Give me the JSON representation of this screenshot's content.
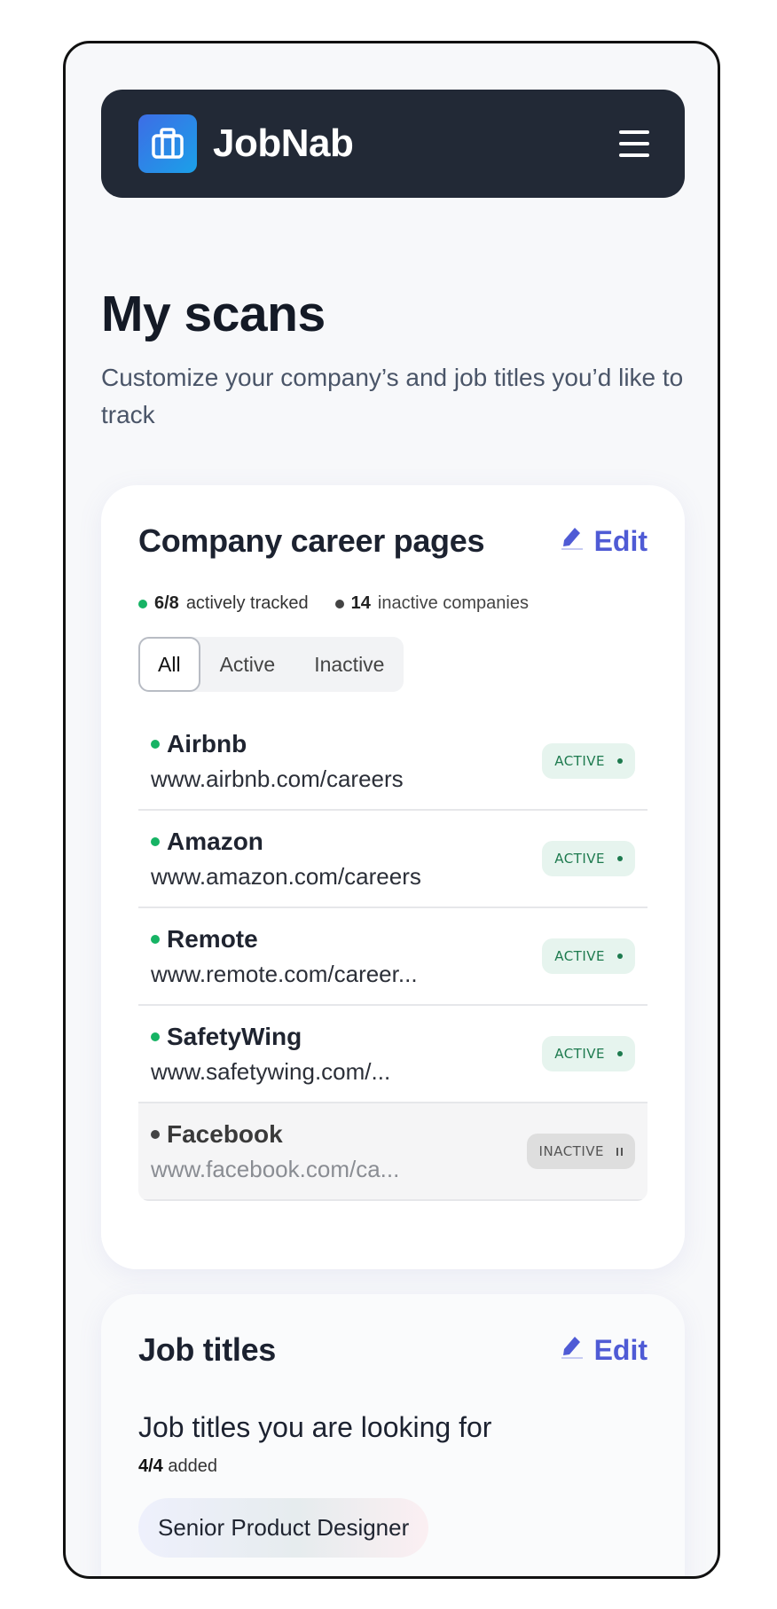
{
  "header": {
    "brand_name": "JobNab",
    "logo_icon": "briefcase-icon",
    "menu_icon": "hamburger-menu-icon"
  },
  "page": {
    "title": "My scans",
    "subtitle": "Customize your company’s and job titles you’d like to track"
  },
  "companies_card": {
    "title": "Company career pages",
    "edit_label": "Edit",
    "stats": {
      "active_count": "6/8",
      "active_text": "actively tracked",
      "inactive_count": "14",
      "inactive_text": "inactive companies"
    },
    "filters": [
      "All",
      "Active",
      "Inactive"
    ],
    "selected_filter": "All",
    "companies": [
      {
        "name": "Airbnb",
        "url": "www.airbnb.com/careers",
        "status": "ACTIVE"
      },
      {
        "name": "Amazon",
        "url": "www.amazon.com/careers",
        "status": "ACTIVE"
      },
      {
        "name": "Remote",
        "url": "www.remote.com/career...",
        "status": "ACTIVE"
      },
      {
        "name": "SafetyWing",
        "url": "www.safetywing.com/...",
        "status": "ACTIVE"
      },
      {
        "name": "Facebook",
        "url": "www.facebook.com/ca...",
        "status": "INACTIVE"
      }
    ]
  },
  "job_titles_card": {
    "title": "Job titles",
    "edit_label": "Edit",
    "question": "Job titles you are looking for",
    "count": "4/4",
    "count_text": "added",
    "titles": [
      "Senior Product Designer"
    ]
  },
  "colors": {
    "header_bg": "#222936",
    "accent": "#4f5bd5",
    "active_green": "#16b364"
  }
}
